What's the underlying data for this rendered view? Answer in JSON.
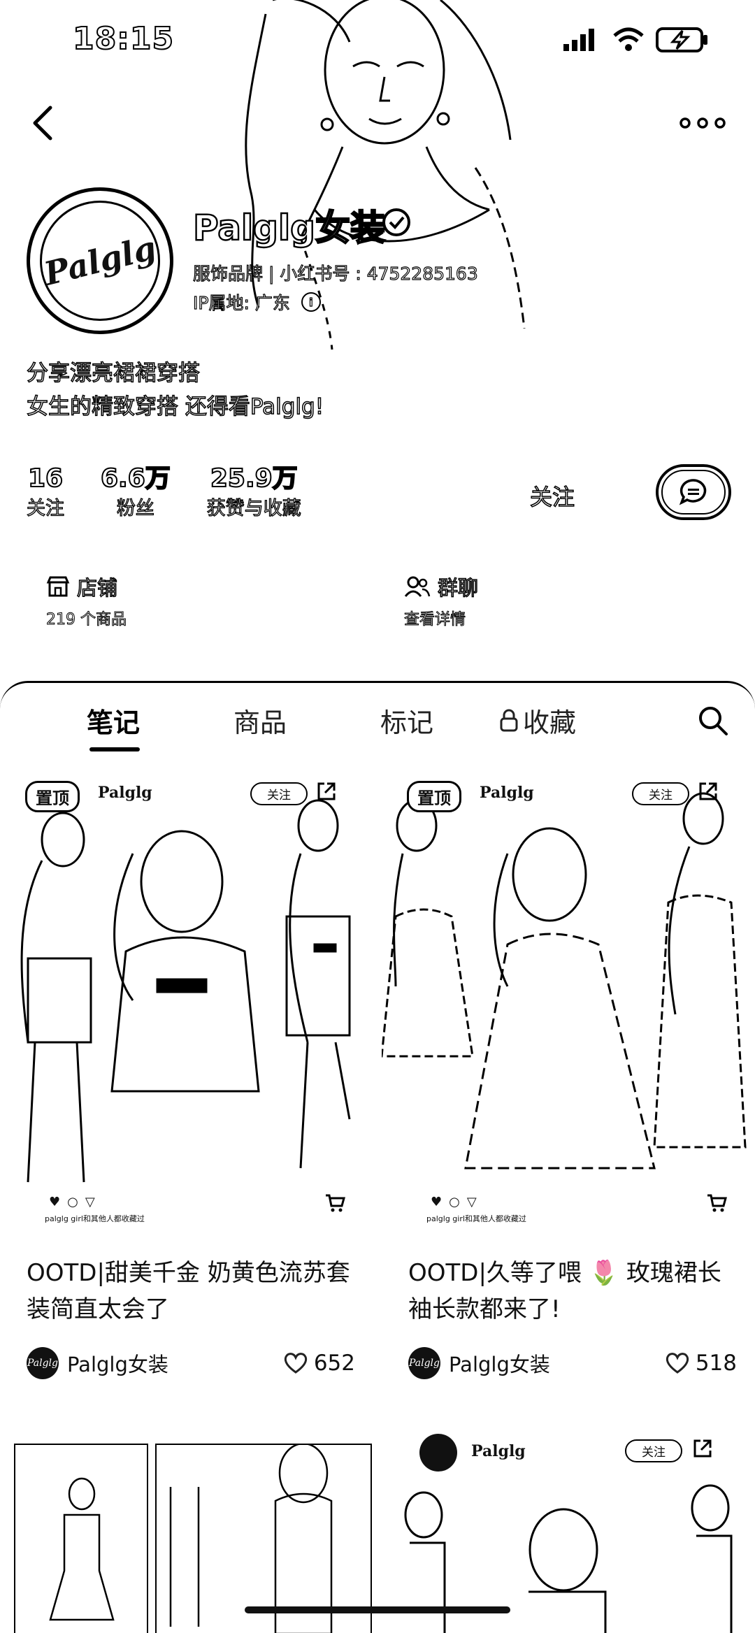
{
  "status_bar": {
    "time": "18:15"
  },
  "profile": {
    "avatar_text": "Palglg",
    "name": "Palglg女装",
    "category": "服饰品牌",
    "id_label": "小红书号",
    "id_value": "4752285163",
    "ip_location": "IP属地: 广东",
    "bio_line1": "分享漂亮裙裙穿搭",
    "bio_line2": "女生的精致穿搭 还得看Palglg!",
    "stats": [
      {
        "value": "16",
        "label": "关注"
      },
      {
        "value": "6.6万",
        "label": "粉丝"
      },
      {
        "value": "25.9万",
        "label": "获赞与收藏"
      }
    ],
    "follow_label": "关注",
    "shortcuts": {
      "shop": {
        "title": "店铺",
        "sub": "219 个商品"
      },
      "group": {
        "title": "群聊",
        "sub": "查看详情"
      }
    }
  },
  "tabs": [
    "笔记",
    "商品",
    "标记",
    "收藏"
  ],
  "notes": [
    {
      "pin": "置顶",
      "brand": "Palglg",
      "follow": "关注",
      "caption": "palglg girl和其他人都收藏过",
      "title": "OOTD|甜美千金 奶黄色流苏套装简直太会了",
      "author": "Palglg女装",
      "author_avatar_text": "Palglg",
      "likes": "652"
    },
    {
      "pin": "置顶",
      "brand": "Palglg",
      "follow": "关注",
      "caption": "palglg girl和其他人都收藏过",
      "title": "OOTD|久等了喂 🌷 玫瑰裙长袖长款都来了!",
      "author": "Palglg女装",
      "author_avatar_text": "Palglg",
      "likes": "518"
    }
  ],
  "row2": {
    "brand": "Palglg",
    "follow": "关注"
  },
  "colors": {
    "ink": "#000000",
    "paper": "#ffffff"
  }
}
